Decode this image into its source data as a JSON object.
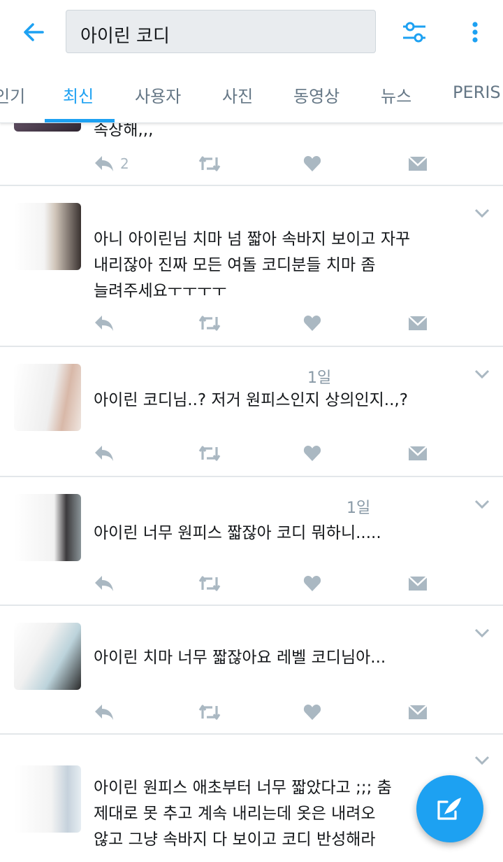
{
  "header": {
    "search_value": "아이린 코디",
    "back_icon": "arrow-left-icon",
    "filter_icon": "filter-sliders-icon",
    "more_icon": "more-vertical-icon"
  },
  "tabs": [
    {
      "label": "인기"
    },
    {
      "label": "최신"
    },
    {
      "label": "사용자"
    },
    {
      "label": "사진"
    },
    {
      "label": "동영상"
    },
    {
      "label": "뉴스"
    },
    {
      "label": "PERIS"
    }
  ],
  "active_tab": "최신",
  "tweets": [
    {
      "meta": "",
      "text": "속상해,,,",
      "reply_count": "2"
    },
    {
      "meta": "",
      "text": "아니 아이린님 치마 넘 짧아 속바지 보이고 자꾸\n내리잖아 진짜 모든 여돌 코디분들 치마 좀\n늘려주세요ㅜㅜㅜㅜ",
      "reply_count": ""
    },
    {
      "meta": "1일",
      "text": "아이린 코디님..? 저거 원피스인지 상의인지..,?",
      "reply_count": ""
    },
    {
      "meta": "1일",
      "text": "아이린 너무 원피스 짧잖아 코디 뭐하니.....",
      "reply_count": ""
    },
    {
      "meta": "",
      "text": "아이린 치마 너무 짧잖아요 레벨 코디님아...",
      "reply_count": ""
    },
    {
      "meta": "",
      "text": "아이린 원피스 애초부터 너무 짧았다고 ;;; 춤\n제대로 못 추고 계속 내리는데 옷은 내려오\n않고 그냥 속바지 다 보이고 코디 반성해라",
      "reply_count": ""
    }
  ],
  "colors": {
    "accent": "#1da1f2",
    "icon_gray": "#aab8c2",
    "text": "#14171a",
    "meta": "#8899a6"
  },
  "icons": {
    "reply": "reply-icon",
    "retweet": "retweet-icon",
    "like": "heart-icon",
    "dm": "envelope-icon",
    "caret": "chevron-down-icon",
    "compose": "compose-tweet-icon"
  }
}
